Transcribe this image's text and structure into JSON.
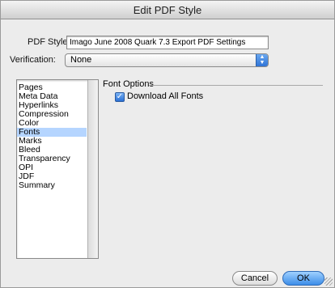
{
  "window": {
    "title": "Edit PDF Style"
  },
  "pdf_style": {
    "label": "PDF Style:",
    "value": "Imago June 2008 Quark 7.3 Export PDF Settings"
  },
  "verification": {
    "label": "Verification:",
    "value": "None"
  },
  "sections": {
    "items": [
      "Pages",
      "Meta Data",
      "Hyperlinks",
      "Compression",
      "Color",
      "Fonts",
      "Marks",
      "Bleed",
      "Transparency",
      "OPI",
      "JDF",
      "Summary"
    ],
    "selected": "Fonts"
  },
  "font_options": {
    "group_label": "Font Options",
    "download_all_fonts": {
      "label": "Download All Fonts",
      "checked": true
    }
  },
  "buttons": {
    "cancel": "Cancel",
    "ok": "OK"
  },
  "colors": {
    "accent": "#3d8ee8",
    "selection": "#b5d5ff"
  }
}
